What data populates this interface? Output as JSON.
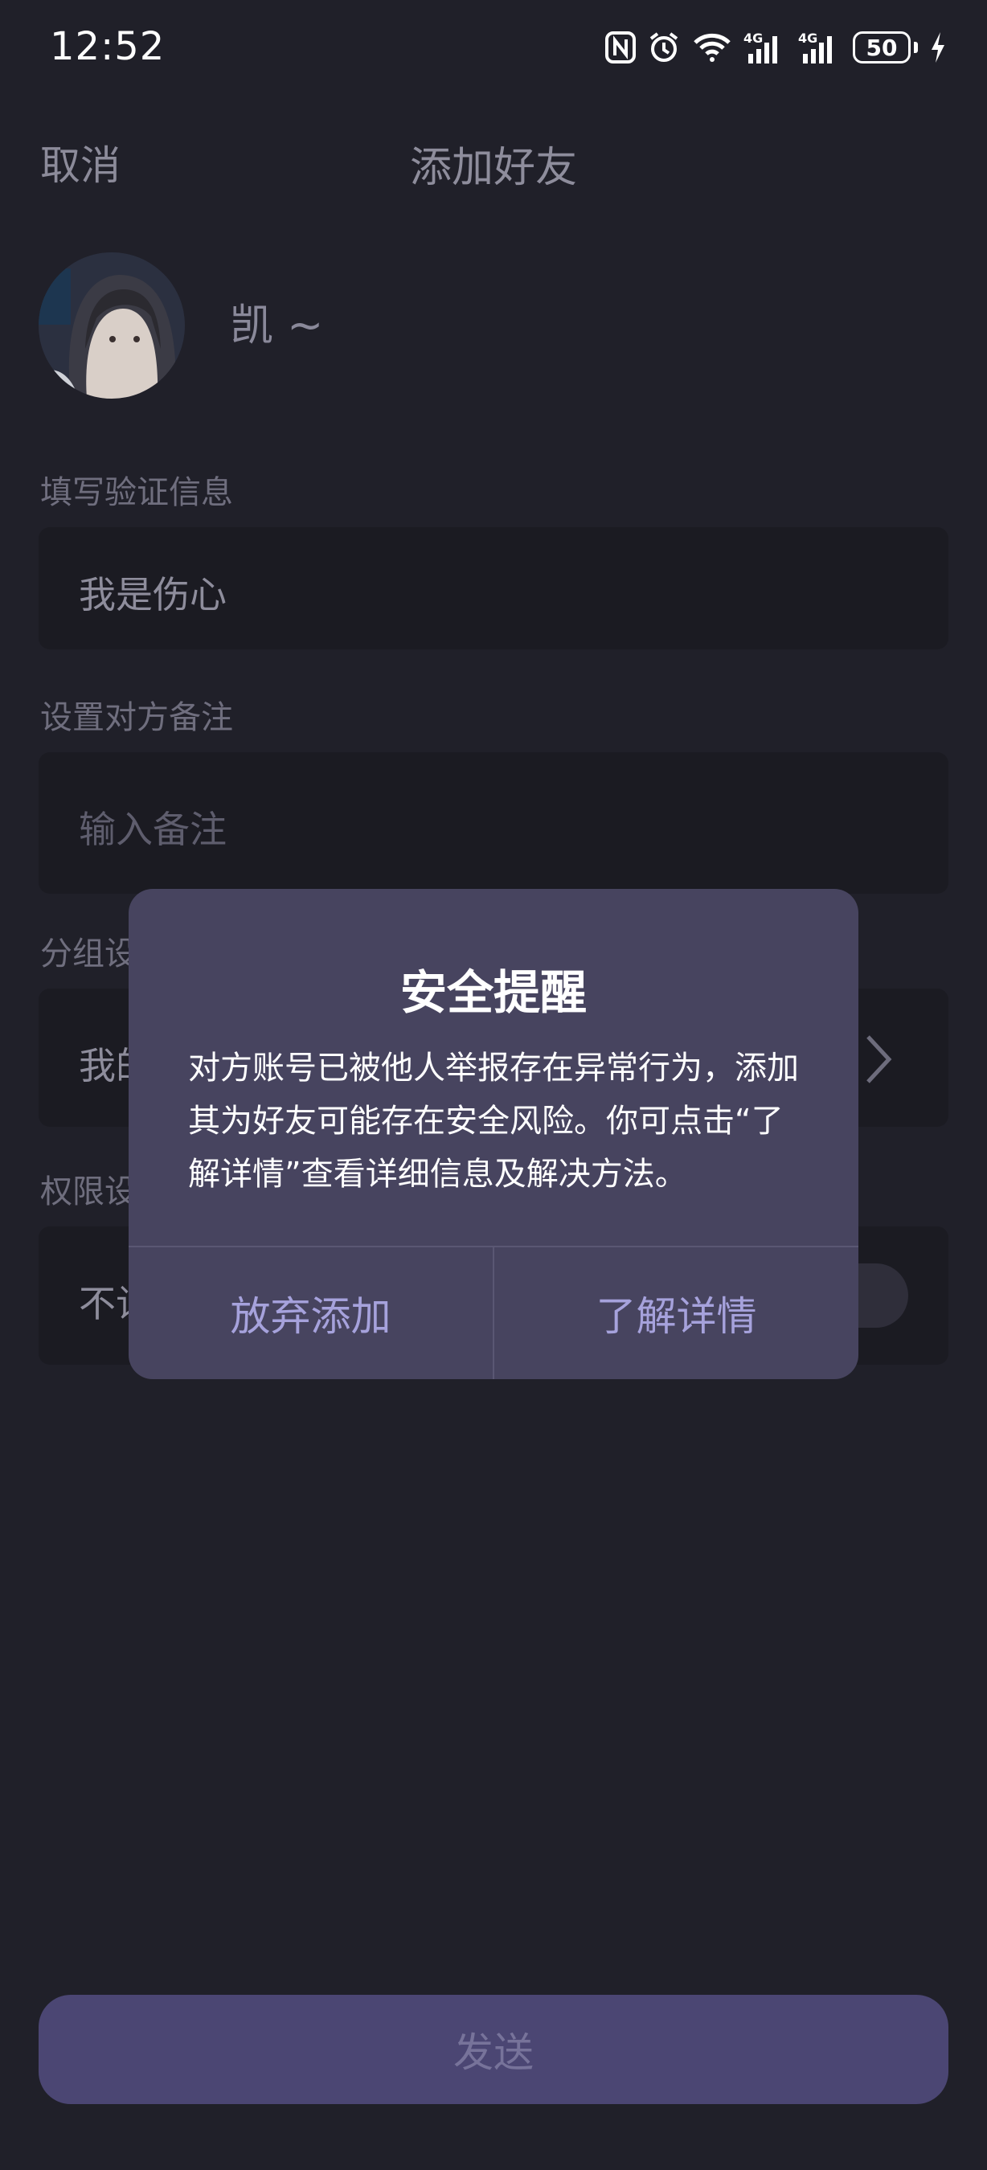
{
  "status_bar": {
    "time": "12:52",
    "battery": "50",
    "icons": [
      "nfc-icon",
      "alarm-icon",
      "wifi-icon",
      "4g-signal-icon",
      "4g-signal-icon",
      "battery-icon",
      "charging-icon"
    ],
    "network_label": "4G"
  },
  "nav": {
    "cancel": "取消",
    "title": "添加好友"
  },
  "profile": {
    "nickname": "凯 ~"
  },
  "form": {
    "verify_label": "填写验证信息",
    "verify_value": "我是伤心",
    "remark_label": "设置对方备注",
    "remark_placeholder": "输入备注",
    "group_label": "分组设",
    "group_value": "我的",
    "permission_label": "权限设",
    "permission_value": "不让"
  },
  "send_button": "发送",
  "dialog": {
    "title": "安全提醒",
    "message": "对方账号已被他人举报存在异常行为，添加其为好友可能存在安全风险。你可点击“了解详情”查看详细信息及解决方法。",
    "cancel_button": "放弃添加",
    "confirm_button": "了解详情"
  },
  "colors": {
    "background": "#202029",
    "field_background": "#1b1b22",
    "dialog_background": "#47445f",
    "accent": "#a6a2dc",
    "send_button": "#4b4673"
  }
}
